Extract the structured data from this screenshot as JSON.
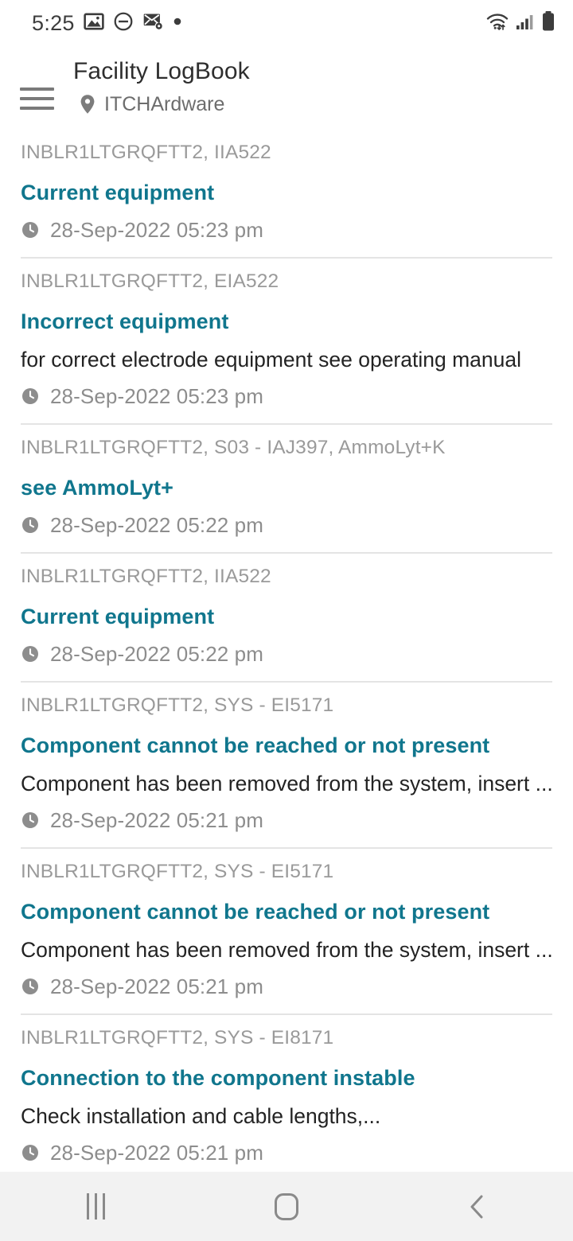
{
  "status_bar": {
    "time": "5:25",
    "left_icons": [
      "image-icon",
      "do-not-disturb-icon",
      "mail-settings-icon",
      "dot-icon"
    ],
    "right_icons": [
      "wifi-icon",
      "cellular-signal-icon",
      "battery-icon"
    ]
  },
  "app_bar": {
    "menu_icon": "hamburger-menu-icon",
    "title": "Facility LogBook",
    "location_icon": "location-pin-icon",
    "subtitle": "ITCHArdware"
  },
  "log_entries": [
    {
      "meta": "INBLR1LTGRQFTT2, IIA522",
      "title": "Current equipment",
      "description": "",
      "timestamp": "28-Sep-2022 05:23 pm"
    },
    {
      "meta": "INBLR1LTGRQFTT2, EIA522",
      "title": "Incorrect equipment",
      "description": "for correct electrode equipment see operating manual",
      "timestamp": "28-Sep-2022 05:23 pm"
    },
    {
      "meta": "INBLR1LTGRQFTT2, S03 - IAJ397, AmmoLyt+K",
      "title": "see AmmoLyt+",
      "description": "",
      "timestamp": "28-Sep-2022 05:22 pm"
    },
    {
      "meta": "INBLR1LTGRQFTT2, IIA522",
      "title": "Current equipment",
      "description": "",
      "timestamp": "28-Sep-2022 05:22 pm"
    },
    {
      "meta": "INBLR1LTGRQFTT2, SYS - EI5171",
      "title": "Component cannot be reached or not present",
      "description": "Component has been removed from the system, insert ...",
      "timestamp": "28-Sep-2022 05:21 pm"
    },
    {
      "meta": "INBLR1LTGRQFTT2, SYS - EI5171",
      "title": "Component cannot be reached or not present",
      "description": "Component has been removed from the system, insert ...",
      "timestamp": "28-Sep-2022 05:21 pm"
    },
    {
      "meta": "INBLR1LTGRQFTT2, SYS - EI8171",
      "title": "Connection to the component instable",
      "description": "Check installation and cable lengths,...",
      "timestamp": "28-Sep-2022 05:21 pm"
    }
  ],
  "nav_bar": {
    "recents_label": "recents-icon",
    "home_label": "home-icon",
    "back_label": "back-icon"
  },
  "colors": {
    "accent_teal": "#10768d",
    "meta_gray": "#9a9a9a",
    "body_text": "#232323",
    "divider": "#e4e4e4",
    "nav_bg": "#f2f2f2"
  }
}
